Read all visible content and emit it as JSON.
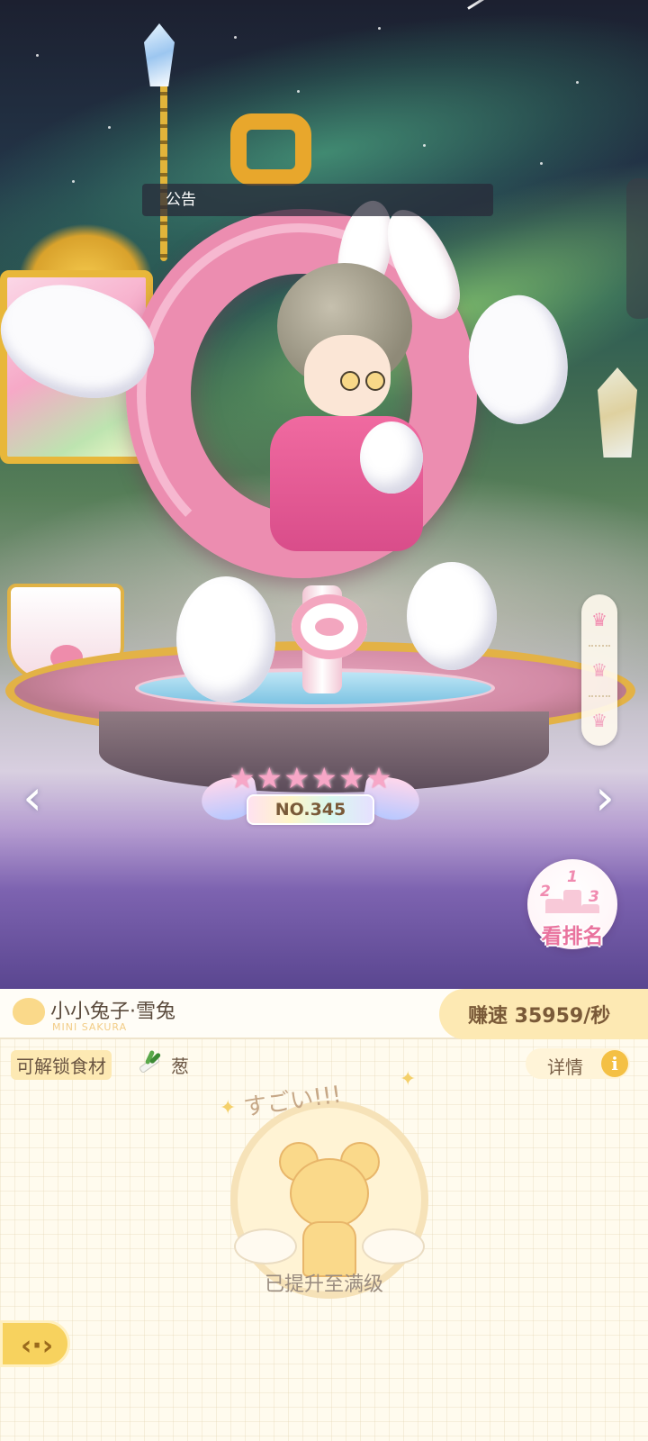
{
  "notice": {
    "label": "公告"
  },
  "badge": {
    "stars": 6,
    "number": "NO.345"
  },
  "leaderboard": {
    "label": "看排名",
    "podium_numbers": [
      "2",
      "1",
      "3"
    ]
  },
  "rank_tabs": [
    {
      "icon": "crown-icon",
      "active": true
    },
    {
      "icon": "crown-icon",
      "active": false
    },
    {
      "icon": "crown-icon",
      "active": false
    }
  ],
  "nav": {
    "prev_icon": "chevron-left-icon",
    "next_icon": "chevron-right-icon"
  },
  "character": {
    "name": "小小兔子·雪兔",
    "subtitle": "MINI SAKURA"
  },
  "earn": {
    "label": "赚速 35959/秒"
  },
  "unlock": {
    "label": "可解锁食材",
    "item_icon": "leek-icon",
    "item": "葱"
  },
  "details": {
    "label": "详情",
    "icon": "info-icon"
  },
  "medal": {
    "title": "すごい!!!"
  },
  "status": {
    "text": "已提升至满级"
  },
  "back": {
    "icon": "back-arrow-icon"
  },
  "colors": {
    "accent": "#fde9b3",
    "pink": "#e9739e",
    "gold": "#f4c044",
    "panel_bg": "#fffbee"
  }
}
